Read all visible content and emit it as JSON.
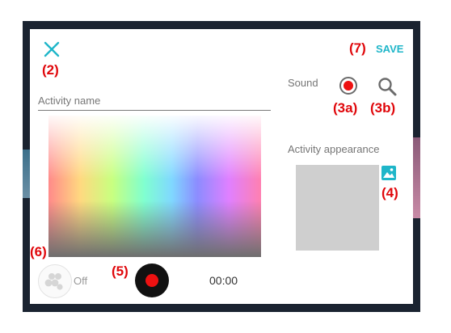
{
  "dialog": {
    "save_label": "SAVE",
    "activity_name_placeholder": "Activity name",
    "sound_label": "Sound",
    "appearance_label": "Activity appearance",
    "loop_state": "Off",
    "timer": "00:00"
  },
  "annotations": {
    "close": "(2)",
    "record_sound": "(3a)",
    "search_sound": "(3b)",
    "image": "(4)",
    "record": "(5)",
    "loop": "(6)",
    "save": "(7)"
  },
  "colors": {
    "accent": "#1fb6c9",
    "annotation": "#e0070b",
    "record": "#ee1111",
    "appearance_placeholder": "#cfcfcf"
  },
  "icons": [
    "close-icon",
    "record-icon",
    "search-icon",
    "image-icon",
    "loop-icon"
  ]
}
